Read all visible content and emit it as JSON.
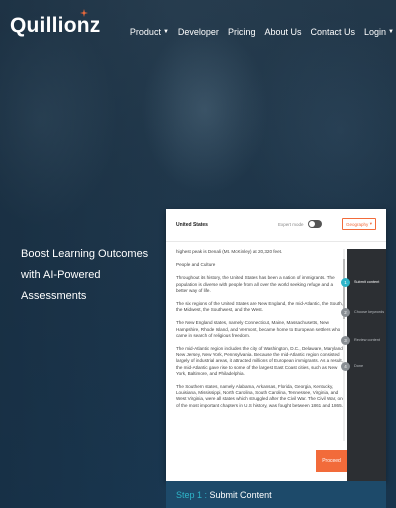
{
  "brand": {
    "name": "Quillionz"
  },
  "nav": {
    "items": [
      {
        "label": "Product",
        "has_dropdown": true
      },
      {
        "label": "Developer",
        "has_dropdown": false
      },
      {
        "label": "Pricing",
        "has_dropdown": false
      },
      {
        "label": "About Us",
        "has_dropdown": false
      },
      {
        "label": "Contact Us",
        "has_dropdown": false
      },
      {
        "label": "Login",
        "has_dropdown": true
      }
    ]
  },
  "hero": {
    "tagline": "Boost Learning Outcomes with AI-Powered Assessments"
  },
  "app": {
    "doc_title": "United States",
    "expert_mode_label": "Expert mode",
    "expert_mode_on": false,
    "domain_select": "Geography",
    "paragraphs": [
      "highest peak is Denali (Mt. McKinley) at 20,320 feet.",
      "People and Culture",
      "Throughout its history, the United States has been a nation of immigrants. The population is diverse with people from all over the world seeking refuge and a better way of life.",
      "The six regions of the United States are New England, the mid-Atlantic, the South, the Midwest, the Southwest, and the West.",
      "The New England states, namely Connecticut, Maine, Massachusetts, New Hampshire, Rhode Island, and Vermont, became home to European settlers who came in search of religious freedom.",
      "The mid-Atlantic region includes the city of Washington, D.C., Delaware, Maryland, New Jersey, New York, Pennsylvania. Because the mid-Atlantic region consisted largely of industrial areas, it attracted millions of European immigrants. As a result, the mid-Atlantic gave rise to some of the largest East Coast cities, such as New York, Baltimore, and Philadelphia.",
      "The Southern states, namely Alabama, Arkansas, Florida, Georgia, Kentucky, Louisiana, Mississippi, North Carolina, South Carolina, Tennessee, Virginia, and West Virginia, were all states which struggled after the Civil War. The Civil War, one of the most important chapters in U.S history, was fought between 1861 and 1865."
    ],
    "steps": [
      {
        "num": "1",
        "label": "Submit content",
        "active": true
      },
      {
        "num": "2",
        "label": "Choose keywords",
        "active": false
      },
      {
        "num": "3",
        "label": "Review content",
        "active": false
      },
      {
        "num": "4",
        "label": "Done",
        "active": false
      }
    ],
    "proceed_label": "Proceed"
  },
  "step_banner": {
    "prefix": "Step 1 :",
    "text": "Submit Content"
  },
  "colors": {
    "accent": "#f26b3a",
    "teal": "#2fb5c9",
    "panel": "#2c2f33",
    "banner": "#1d4a6a"
  }
}
